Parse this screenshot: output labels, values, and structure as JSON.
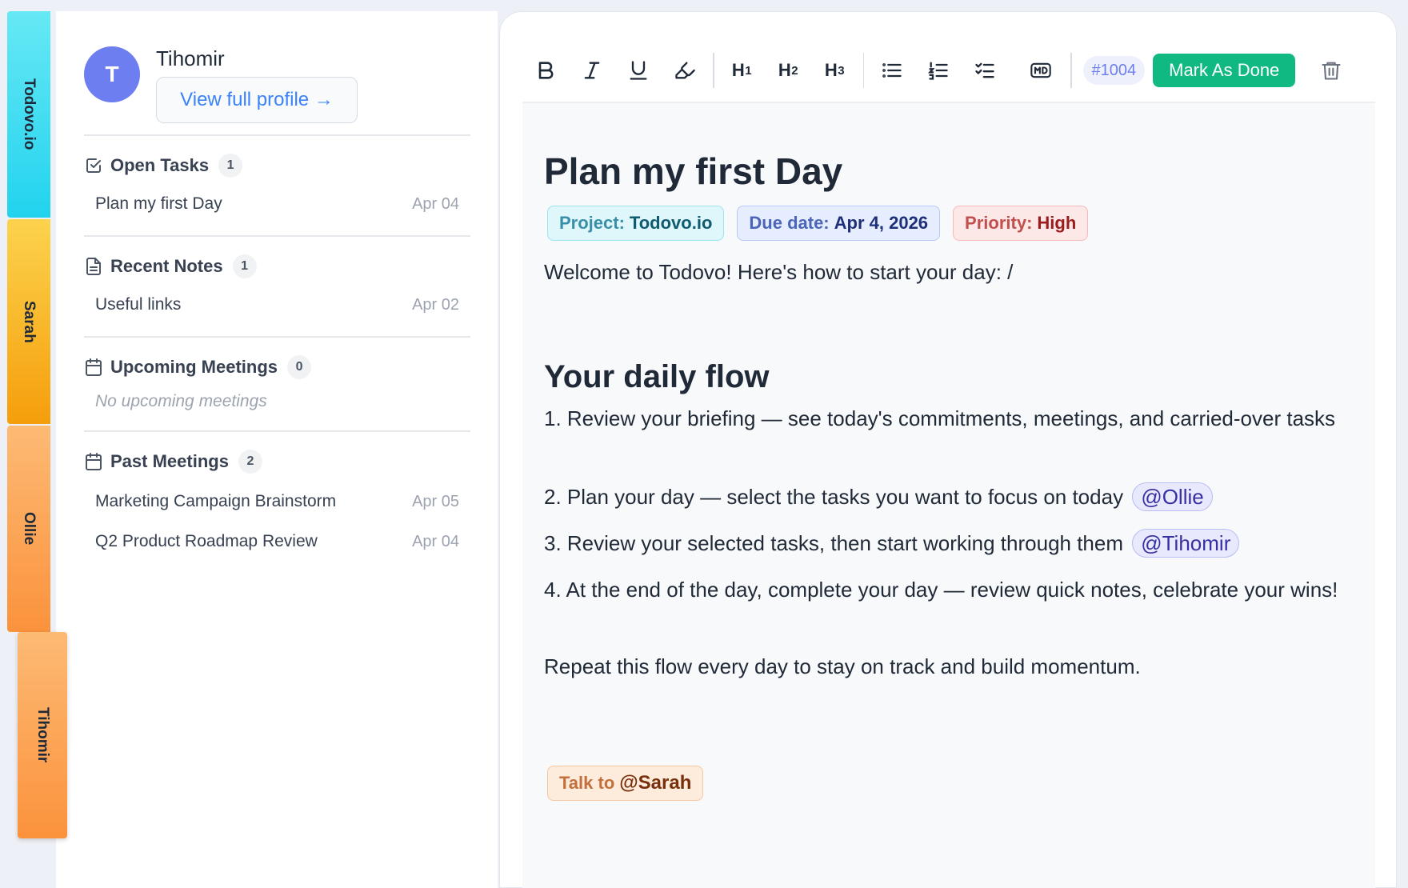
{
  "tabs": [
    {
      "label": "Todovo.io",
      "color": "#22d3ee"
    },
    {
      "label": "Sarah",
      "color": "#f59e0b"
    },
    {
      "label": "Ollie",
      "color": "#fb923c"
    },
    {
      "label": "Tihomir",
      "color": "#fb923c"
    }
  ],
  "profile": {
    "initial": "T",
    "name": "Tihomir",
    "link_label": "View full profile →"
  },
  "sidebar": {
    "open_tasks": {
      "title": "Open Tasks",
      "count": "1",
      "icon": "checkbox-icon",
      "items": [
        {
          "label": "Plan my first Day",
          "date": "Apr 04"
        }
      ]
    },
    "recent_notes": {
      "title": "Recent Notes",
      "count": "1",
      "icon": "document-icon",
      "items": [
        {
          "label": "Useful links",
          "date": "Apr 02"
        }
      ]
    },
    "upcoming_meetings": {
      "title": "Upcoming Meetings",
      "count": "0",
      "icon": "calendar-icon",
      "empty_text": "No upcoming meetings"
    },
    "past_meetings": {
      "title": "Past Meetings",
      "count": "2",
      "icon": "calendar-icon",
      "items": [
        {
          "label": "Marketing Campaign Brainstorm",
          "date": "Apr 05"
        },
        {
          "label": "Q2 Product Roadmap Review",
          "date": "Apr 04"
        }
      ]
    }
  },
  "toolbar": {
    "h1": "H",
    "h1_sub": "1",
    "h2": "H",
    "h2_sub": "2",
    "h3": "H",
    "h3_sub": "3",
    "task_id": "#1004",
    "done_label": "Mark As Done"
  },
  "document": {
    "title": "Plan my first Day",
    "badges": {
      "project_key": "Project:",
      "project_val": "Todovo.io",
      "due_key": "Due date:",
      "due_val": "Apr 4, 2026",
      "priority_key": "Priority:",
      "priority_val": "High"
    },
    "welcome": "Welcome to Todovo! Here's how to start your day: /",
    "heading": "Your daily flow",
    "steps": [
      {
        "text": "1. Review your briefing — see today's commitments, meetings, and carried-over tasks",
        "mention": ""
      },
      {
        "text": "2. Plan your day — select the tasks you want to focus on today",
        "mention": "@Ollie"
      },
      {
        "text": "3. Review your selected tasks, then start working through them",
        "mention": "@Tihomir"
      },
      {
        "text": "4. At the end of the day, complete your day — review quick notes, celebrate your wins!",
        "mention": ""
      }
    ],
    "closing": "Repeat this flow every day to stay on track and build momentum.",
    "talk_key": "Talk to",
    "talk_val": "@Sarah"
  },
  "colors": {
    "accent": "#10b981",
    "avatar": "#6d7ff0",
    "link": "#3b82f6"
  }
}
